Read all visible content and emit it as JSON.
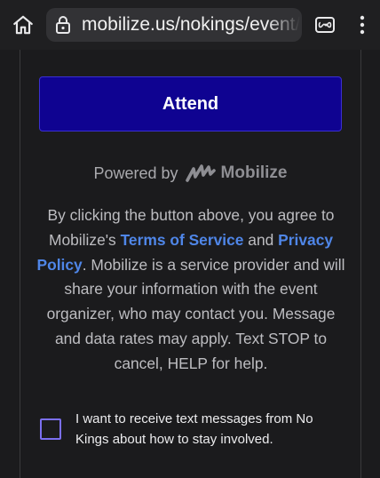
{
  "browser": {
    "url": "mobilize.us/nokings/event/",
    "icons": {
      "home": "home-icon",
      "lock": "lock-icon",
      "tabs": "tabs-icon",
      "menu": "more-vert-icon"
    }
  },
  "event": {
    "attend_label": "Attend"
  },
  "powered": {
    "prefix": "Powered by",
    "brand": "Mobilize"
  },
  "disclaimer": {
    "p1": "By clicking the button above, you agree to Mobilize's ",
    "terms_link": "Terms of Service",
    "and": " and ",
    "privacy_link": "Privacy Policy",
    "p2": ". Mobilize is a service provider and will share your information with the event organizer, who may contact you. Message and data rates may apply. Text STOP to cancel, HELP for help."
  },
  "optin": {
    "checked": false,
    "label": "I want to receive text messages from No Kings about how to stay involved."
  },
  "colors": {
    "background": "#1b1b1d",
    "attend_button": "#0f0391",
    "link": "#4f86e8",
    "checkbox_border": "#7b6ff0"
  }
}
